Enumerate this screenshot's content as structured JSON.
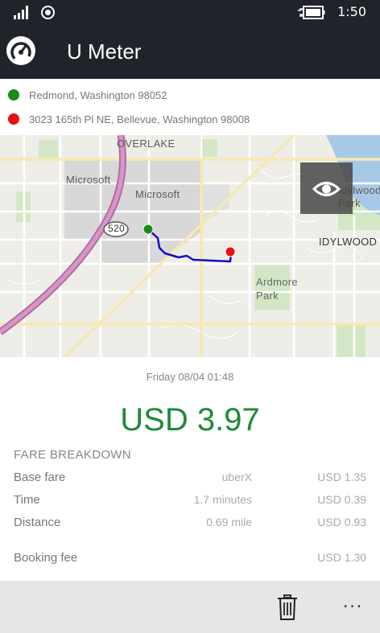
{
  "status_bar": {
    "time": "1:50",
    "icons": [
      "signal-icon",
      "location-radio-icon",
      "battery-charging-icon"
    ]
  },
  "app_bar": {
    "title": "U Meter",
    "logo_icon": "speedometer-icon"
  },
  "route": {
    "start_address": "Redmond, Washington 98052",
    "end_address": "3023 165th Pl NE, Bellevue, Washington 98008",
    "start_color": "#1a8a1a",
    "end_color": "#e81010"
  },
  "map": {
    "labels": {
      "overlake": "OVERLAKE",
      "microsoft_1": "Microsoft",
      "microsoft_2": "Microsoft",
      "highway": "520",
      "idylwood_park": "Idylwood Park",
      "idylwood": "IDYLWOOD",
      "ardmore_park": "Ardmore Park"
    },
    "route_color": "#1010c8",
    "toggle_icon": "eye-icon"
  },
  "trip": {
    "date": "Friday 08/04 01:48",
    "total": "USD 3.97",
    "total_color": "#1e8a3a",
    "breakdown_heading": "FARE BREAKDOWN",
    "rows": [
      {
        "label": "Base fare",
        "detail": "uberX",
        "amount": "USD 1.35"
      },
      {
        "label": "Time",
        "detail": "1.7 minutes",
        "amount": "USD 0.39"
      },
      {
        "label": "Distance",
        "detail": "0.69 mile",
        "amount": "USD 0.93"
      }
    ],
    "booking_fee": {
      "label": "Booking fee",
      "amount": "USD 1.30"
    }
  },
  "bottom_bar": {
    "delete_icon": "trash-icon",
    "more_label": "..."
  }
}
